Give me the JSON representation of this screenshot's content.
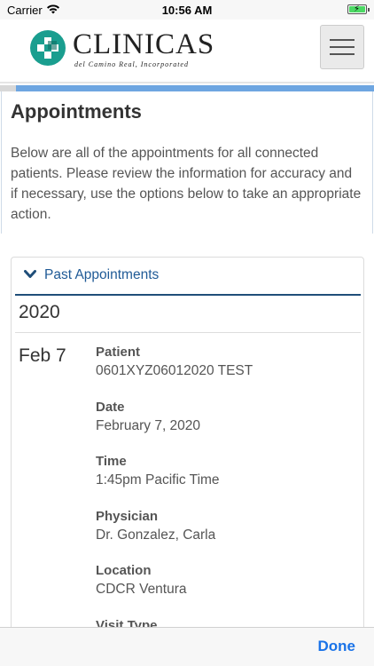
{
  "status_bar": {
    "carrier": "Carrier",
    "time": "10:56 AM"
  },
  "header": {
    "logo_text": "CLINICAS",
    "logo_subtitle": "del Camino Real, Incorporated"
  },
  "page": {
    "title": "Appointments",
    "intro": "Below are all of the appointments for all connected patients. Please review the information for accuracy and if necessary, use the options below to take an appropriate action."
  },
  "panel": {
    "heading": "Past Appointments",
    "year": "2020",
    "appointment": {
      "date_short": "Feb 7",
      "fields": [
        {
          "label": "Patient",
          "value": "0601XYZ06012020 TEST"
        },
        {
          "label": "Date",
          "value": "February 7, 2020"
        },
        {
          "label": "Time",
          "value": "1:45pm Pacific Time"
        },
        {
          "label": "Physician",
          "value": "Dr. Gonzalez, Carla"
        },
        {
          "label": "Location",
          "value": "CDCR Ventura"
        },
        {
          "label": "Visit Type",
          "value": ""
        }
      ]
    }
  },
  "toolbar": {
    "done_label": "Done"
  },
  "colors": {
    "accent": "#1f5a96",
    "logo_teal": "#1a9e8f",
    "done_blue": "#1a73e8"
  }
}
